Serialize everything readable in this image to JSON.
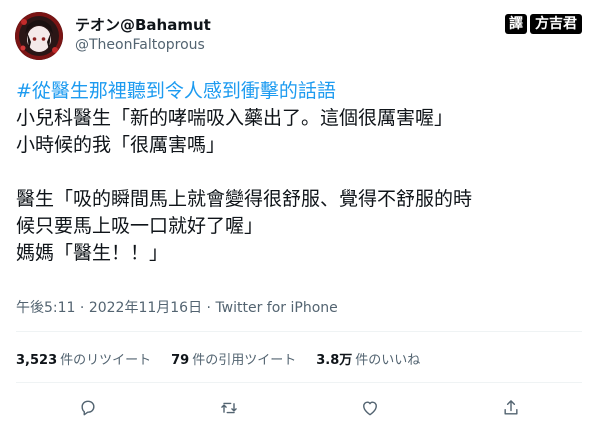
{
  "author": {
    "display_name": "テオン@Bahamut",
    "handle": "@TheonFaltoprous"
  },
  "watermark": {
    "prefix": "譯",
    "name": "方吉君"
  },
  "tweet": {
    "hashtag": "#從醫生那裡聽到令人感到衝擊的話語",
    "lines": [
      "小兒科醫生「新的哮喘吸入藥出了。這個很厲害喔」",
      "小時候的我「很厲害嗎」",
      "醫生「吸的瞬間馬上就會變得很舒服、覺得不舒服的時",
      "候只要馬上吸一口就好了喔」",
      "媽媽「醫生！！」"
    ]
  },
  "meta": {
    "time": "午後5:11",
    "separator": " · ",
    "date": "2022年11月16日",
    "source": "Twitter for iPhone"
  },
  "stats": {
    "retweets": {
      "count": "3,523",
      "label": "件のリツイート"
    },
    "quotes": {
      "count": "79",
      "label": "件の引用ツイート"
    },
    "likes": {
      "count": "3.8万",
      "label": "件のいいね"
    }
  },
  "icons": {
    "reply": "reply-icon",
    "retweet": "retweet-icon",
    "like": "like-icon",
    "share": "share-icon"
  },
  "colors": {
    "hashtag": "#1d9bf0",
    "secondary_text": "#536471",
    "primary_text": "#0f1419",
    "divider": "#eff3f4"
  }
}
